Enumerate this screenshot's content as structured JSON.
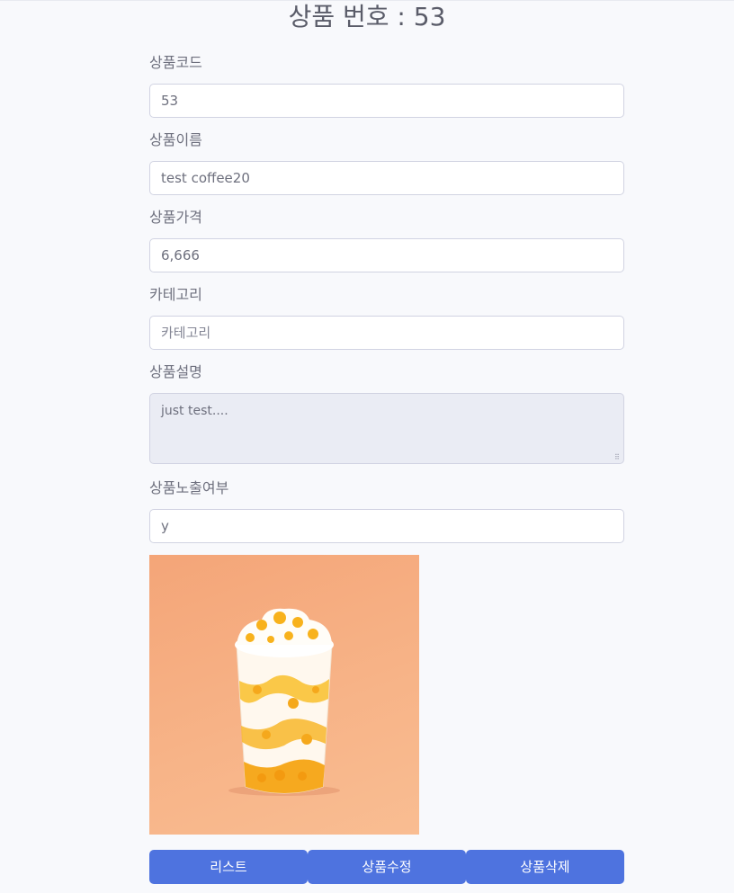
{
  "title": "상품 번호 : 53",
  "fields": {
    "code": {
      "label": "상품코드",
      "value": "53"
    },
    "name": {
      "label": "상품이름",
      "value": "test coffee20"
    },
    "price": {
      "label": "상품가격",
      "value": "6,666"
    },
    "category": {
      "label": "카테고리",
      "placeholder": "카테고리"
    },
    "description": {
      "label": "상품설명",
      "value": "just test...."
    },
    "visible": {
      "label": "상품노출여부",
      "value": "y"
    }
  },
  "image": {
    "alt": "mango frappe drink product photo"
  },
  "buttons": {
    "list": "리스트",
    "edit": "상품수정",
    "delete": "상품삭제"
  },
  "colors": {
    "background": "#f8f9fc",
    "primary": "#4e73df",
    "readonly_bg": "#eaecf4",
    "image_bg": "#f6ad80"
  }
}
